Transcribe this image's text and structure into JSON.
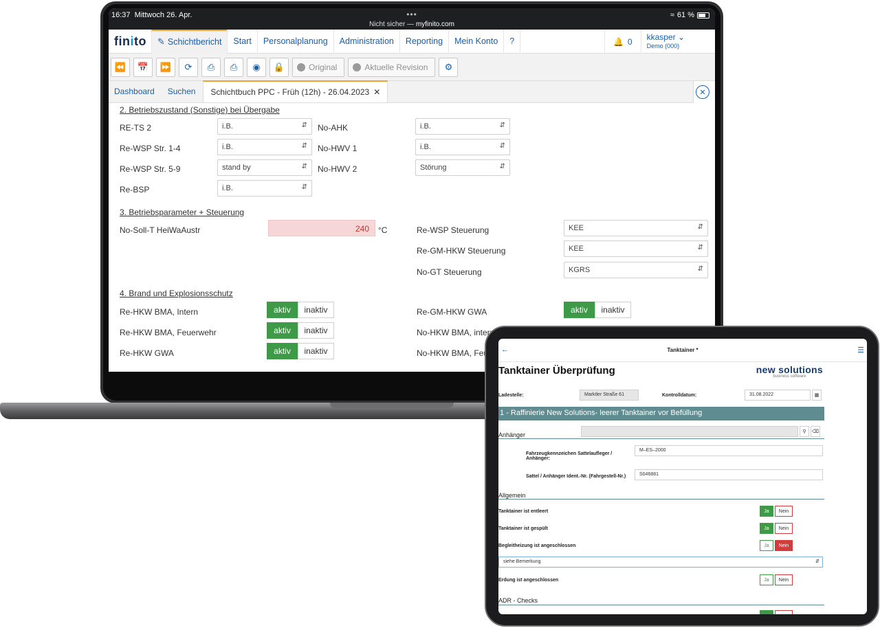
{
  "status_bar": {
    "time": "16:37",
    "date": "Mittwoch 26. Apr.",
    "url_prefix": "Nicht sicher — ",
    "url_host": "myfinito.com",
    "battery": "61 %"
  },
  "nav": {
    "logo_a": "fin",
    "logo_b": "i",
    "logo_c": "to",
    "items": [
      "Schichtbericht",
      "Start",
      "Personalplanung",
      "Administration",
      "Reporting",
      "Mein Konto",
      "?"
    ],
    "notifications": "0",
    "user_name": "kkasper",
    "user_org": "Demo (000)"
  },
  "toolbar": {
    "original_label": "Original",
    "revision_label": "Aktuelle Revision"
  },
  "tabs": {
    "dashboard": "Dashboard",
    "search": "Suchen",
    "active": "Schichtbuch PPC - Früh (12h) - 26.04.2023"
  },
  "section2": {
    "title": "2. Betriebszustand (Sonstige) bei Übergabe",
    "left": [
      {
        "label": "RE-TS 2",
        "value": "i.B."
      },
      {
        "label": "Re-WSP Str. 1-4",
        "value": "i.B."
      },
      {
        "label": "Re-WSP Str. 5-9",
        "value": "stand by"
      },
      {
        "label": "Re-BSP",
        "value": "i.B."
      }
    ],
    "right": [
      {
        "label": "No-AHK",
        "value": "i.B."
      },
      {
        "label": "No-HWV 1",
        "value": "i.B."
      },
      {
        "label": "No-HWV 2",
        "value": "Störung"
      }
    ]
  },
  "section3": {
    "title": "3. Betriebsparameter + Steuerung",
    "soll_label": "No-Soll-T HeiWaAustr",
    "soll_value": "240",
    "soll_unit": "°C",
    "right": [
      {
        "label": "Re-WSP Steuerung",
        "value": "KEE"
      },
      {
        "label": "Re-GM-HKW Steuerung",
        "value": "KEE"
      },
      {
        "label": "No-GT Steuerung",
        "value": "KGRS"
      }
    ]
  },
  "section4": {
    "title": "4. Brand und Explosionsschutz",
    "on_label": "aktiv",
    "off_label": "inaktiv",
    "left": [
      "Re-HKW BMA, Intern",
      "Re-HKW BMA, Feuerwehr",
      "Re-HKW GWA"
    ],
    "right": [
      "Re-GM-HKW GWA",
      "No-HKW BMA, intern",
      "No-HKW BMA, Feue"
    ]
  },
  "tablet": {
    "header_title": "Tanktainer *",
    "heading": "Tanktainer Überprüfung",
    "brand_name": "new solutions",
    "brand_sub": "business software",
    "ladestelle_label": "Ladestelle:",
    "ladestelle_value": "Marktler Straße 61",
    "kontroll_label": "Kontrolldatum:",
    "kontroll_value": "31.08.2022",
    "band": "1 - Raffinierie New Solutions- leerer Tanktainer vor Befüllung",
    "anhaenger": "Anhänger",
    "kennzeichen_label_1": "Fahrzeugkennzeichen Sattelaufleger /",
    "kennzeichen_label_2": "Anhänger:",
    "kennzeichen_value": "M–ES–2000",
    "ident_label": "Sattel / Anhänger Ident.-Nr. (Fahrgestell-Nr.)",
    "ident_value": "S046881",
    "allgemein": "Allgemein",
    "yes": "Ja",
    "no": "Nein",
    "checks": [
      {
        "label": "Tanktainer ist entleert",
        "state": "ja"
      },
      {
        "label": "Tanktainer ist gespült",
        "state": "ja"
      },
      {
        "label": "Begleitheizung ist angeschlossen",
        "state": "nein"
      },
      {
        "label": "Erdung ist angeschlossen",
        "state": "none"
      }
    ],
    "remark": "siehe Bemerkung",
    "adr": "ADR - Checks"
  },
  "colors": {
    "brand_blue": "#1a5ea8",
    "active_green": "#3e9a47",
    "alert_red": "#d23c3c",
    "band_teal": "#5f8c91",
    "tab_accent": "#f0a030"
  }
}
